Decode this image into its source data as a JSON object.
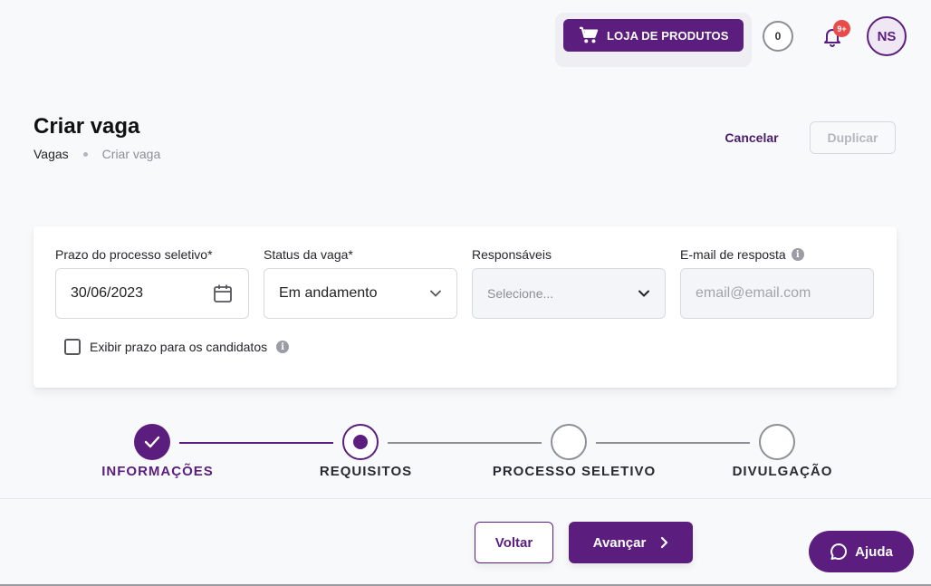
{
  "header": {
    "store_label": "LOJA DE PRODUTOS",
    "coins": "0",
    "notifications_badge": "9+",
    "avatar_initials": "NS"
  },
  "page": {
    "title": "Criar vaga",
    "breadcrumb": [
      "Vagas",
      "Criar vaga"
    ],
    "cancel_label": "Cancelar",
    "duplicate_label": "Duplicar"
  },
  "form": {
    "deadline": {
      "label": "Prazo do processo seletivo*",
      "value": "30/06/2023"
    },
    "status": {
      "label": "Status da vaga*",
      "value": "Em andamento"
    },
    "responsibles": {
      "label": "Responsáveis",
      "placeholder": "Selecione..."
    },
    "reply_email": {
      "label": "E-mail de resposta",
      "placeholder": "email@email.com"
    },
    "show_deadline": {
      "label": "Exibir prazo para os candidatos",
      "checked": false
    }
  },
  "stepper": {
    "steps": [
      {
        "label": "INFORMAÇÕES",
        "state": "done"
      },
      {
        "label": "REQUISITOS",
        "state": "current"
      },
      {
        "label": "PROCESSO SELETIVO",
        "state": "pending"
      },
      {
        "label": "DIVULGAÇÃO",
        "state": "pending"
      }
    ]
  },
  "footer": {
    "back_label": "Voltar",
    "next_label": "Avançar",
    "help_label": "Ajuda"
  },
  "colors": {
    "brand": "#5b1e7e",
    "badge": "#e94b4b",
    "pending": "#8e9097"
  }
}
